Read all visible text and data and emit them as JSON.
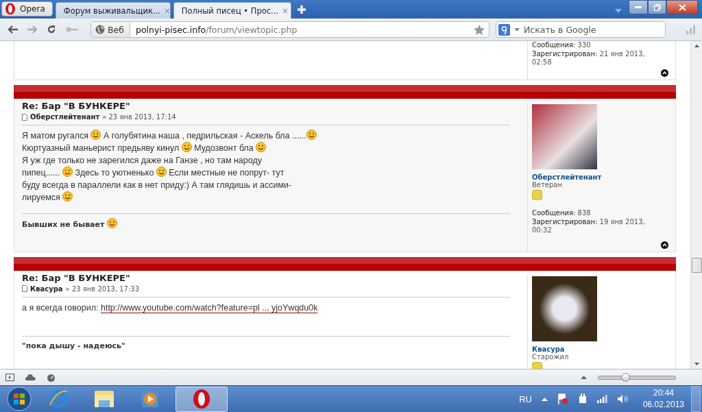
{
  "browser": {
    "menu_button": "Opera",
    "tabs": [
      {
        "title": "Форум выживальщик...",
        "close": "×",
        "selected": false
      },
      {
        "title": "Полный писец • Прос...",
        "close": "×",
        "selected": true
      }
    ],
    "address_bar": {
      "badge": "Веб",
      "host": "polnyi-pisec.info",
      "path": "/forum/viewtopic.php"
    },
    "search": {
      "placeholder": "Искать в Google"
    }
  },
  "posts": [
    {
      "kind": "partial",
      "stats": [
        {
          "label": "Сообщения:",
          "value": "330"
        },
        {
          "label": "Зарегистрирован:",
          "value": "21 янв 2013, 02:58"
        }
      ]
    },
    {
      "kind": "full",
      "title": "Re: Бар \"В БУНКЕРЕ\"",
      "author": "Оберстлейтенант",
      "separator": "»",
      "date": "23 янв 2013, 17:14",
      "body": [
        [
          {
            "kind": "text",
            "text": "Я матом ругался "
          },
          {
            "kind": "smiley"
          },
          {
            "kind": "text",
            "text": " А голубятина наша , педрильская - Аскель бла ......"
          },
          {
            "kind": "smiley"
          }
        ],
        [
          {
            "kind": "text",
            "text": "Кюртуазный маньерист предьяву кинул "
          },
          {
            "kind": "smiley"
          },
          {
            "kind": "text",
            "text": " Мудозвонт бла "
          },
          {
            "kind": "smiley"
          }
        ],
        [
          {
            "kind": "text",
            "text": "Я уж где только не зарегился даже на Ганзе , но там народу"
          }
        ],
        [
          {
            "kind": "text",
            "text": "пипец...... "
          },
          {
            "kind": "smiley"
          },
          {
            "kind": "text",
            "text": " Здесь то уютненько "
          },
          {
            "kind": "smiley"
          },
          {
            "kind": "text",
            "text": " Если местные не попрут- тут"
          }
        ],
        [
          {
            "kind": "text",
            "text": "буду всегда в параллели как в нет приду:) А там глядишь и ассими-"
          }
        ],
        [
          {
            "kind": "text",
            "text": "лируемся "
          },
          {
            "kind": "smiley"
          }
        ]
      ],
      "signature": [
        {
          "kind": "text",
          "text": "Бывших не бывает "
        },
        {
          "kind": "smiley"
        }
      ],
      "profile": {
        "name": "Оберстлейтенант",
        "rank": "Ветеран",
        "stats": [
          {
            "label": "Сообщения:",
            "value": "838"
          },
          {
            "label": "Зарегистрирован:",
            "value": "19 янв 2013, 00:32"
          }
        ]
      }
    },
    {
      "kind": "full",
      "title": "Re: Бар \"В БУНКЕРЕ\"",
      "author": "Квасура",
      "separator": "»",
      "date": "23 янв 2013, 17:33",
      "body": [
        [
          {
            "kind": "text",
            "text": "а я всегда говорил: "
          },
          {
            "kind": "link",
            "text": "http://www.youtube.com/watch?feature=pl ... yjoYwqdu0k"
          }
        ]
      ],
      "signature": [
        {
          "kind": "text",
          "text": "\"пока дышу - надеюсь\""
        }
      ],
      "profile": {
        "name": "Квасура",
        "rank": "Старожил"
      }
    }
  ],
  "status_bar": {
    "zoom": {
      "level": 0.35
    }
  },
  "taskbar": {
    "apps": [
      {
        "kind": "ie",
        "selected": false
      },
      {
        "kind": "explorer",
        "selected": false
      },
      {
        "kind": "media",
        "selected": false
      },
      {
        "kind": "opera",
        "selected": true
      }
    ],
    "language": "RU",
    "time": "20:44",
    "date": "06.02.2013"
  }
}
